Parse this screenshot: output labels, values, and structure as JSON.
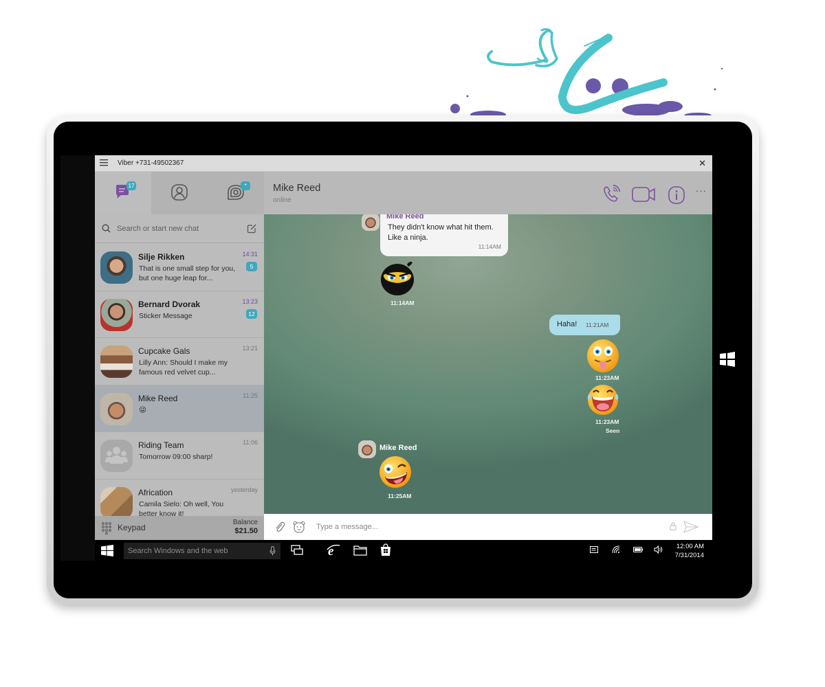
{
  "window": {
    "title": "Viber +731-49502367",
    "close_label": "✕"
  },
  "tabs": [
    {
      "name": "chats",
      "icon": "chat-bubble-icon",
      "badge": "17",
      "active": true
    },
    {
      "name": "contacts",
      "icon": "contact-icon",
      "badge": "",
      "active": false
    },
    {
      "name": "public-chats",
      "icon": "public-chats-icon",
      "badge": "*",
      "active": false
    }
  ],
  "search": {
    "placeholder": "Search or start new chat",
    "icon": "search-icon",
    "compose_icon": "compose-icon"
  },
  "chats": [
    {
      "name": "Silje Rikken",
      "preview": "That is one small step for you, but one huge leap for...",
      "time": "14:31",
      "unread": "5",
      "bold": true
    },
    {
      "name": "Bernard Dvorak",
      "preview": "Sticker Message",
      "time": "13:23",
      "unread": "12",
      "bold": true
    },
    {
      "name": "Cupcake Gals",
      "preview": "Lilly Ann: Should I make my famous red velvet cup...",
      "time": "13:21",
      "unread": "",
      "bold": false
    },
    {
      "name": "Mike Reed",
      "preview": "😜",
      "time": "11:25",
      "unread": "",
      "bold": false,
      "selected": true
    },
    {
      "name": "Riding Team",
      "preview": "Tomorrow 09:00 sharp!",
      "time": "11:06",
      "unread": "",
      "bold": false
    },
    {
      "name": "Africation",
      "preview": "Camila Sielo: Oh well, You better know it!",
      "time": "yesterday",
      "unread": "",
      "bold": false
    }
  ],
  "footer": {
    "keypad_label": "Keypad",
    "balance_label": "Balance",
    "balance_value": "$21.50"
  },
  "conversation": {
    "contact_name": "Mike Reed",
    "status": "online",
    "actions": [
      "voice-call-icon",
      "video-call-icon",
      "info-icon",
      "more-icon"
    ],
    "more_label": "···",
    "messages": [
      {
        "type": "text",
        "direction": "in",
        "sender": "Mike Reed",
        "text_line1": "They didn't know what hit them.",
        "text_line2": "Like a ninja.",
        "time": "11:14AM"
      },
      {
        "type": "sticker",
        "direction": "in",
        "sticker": "ninja-sticker",
        "time": "11:14AM"
      },
      {
        "type": "text",
        "direction": "out",
        "text": "Haha!",
        "time": "11:21AM"
      },
      {
        "type": "sticker",
        "direction": "out",
        "sticker": "tongue-out-sticker",
        "time": "11:23AM"
      },
      {
        "type": "sticker",
        "direction": "out",
        "sticker": "laughing-sticker",
        "time": "11:23AM",
        "status": "Seen"
      },
      {
        "type": "sticker",
        "direction": "in",
        "sender": "Mike Reed",
        "sticker": "winking-sticker",
        "time": "11:25AM"
      }
    ]
  },
  "composer": {
    "placeholder": "Type a message...",
    "attach_icon": "paperclip-icon",
    "sticker_icon": "bear-sticker-icon",
    "lock_icon": "lock-icon",
    "send_icon": "send-icon"
  },
  "taskbar": {
    "search_placeholder": "Search Windows and the web",
    "apps": [
      "task-view-icon",
      "internet-explorer-icon",
      "file-explorer-icon",
      "store-icon"
    ],
    "tray": [
      "notifications-icon",
      "wifi-icon",
      "battery-icon",
      "volume-icon"
    ],
    "time": "12:00 AM",
    "date": "7/31/2014"
  },
  "colors": {
    "accent_purple": "#7b519d",
    "badge_teal": "#3fa8bc",
    "outgoing_bubble": "#abdcea",
    "splash_teal": "#4cc4cb",
    "splash_purple": "#6a58a8"
  }
}
